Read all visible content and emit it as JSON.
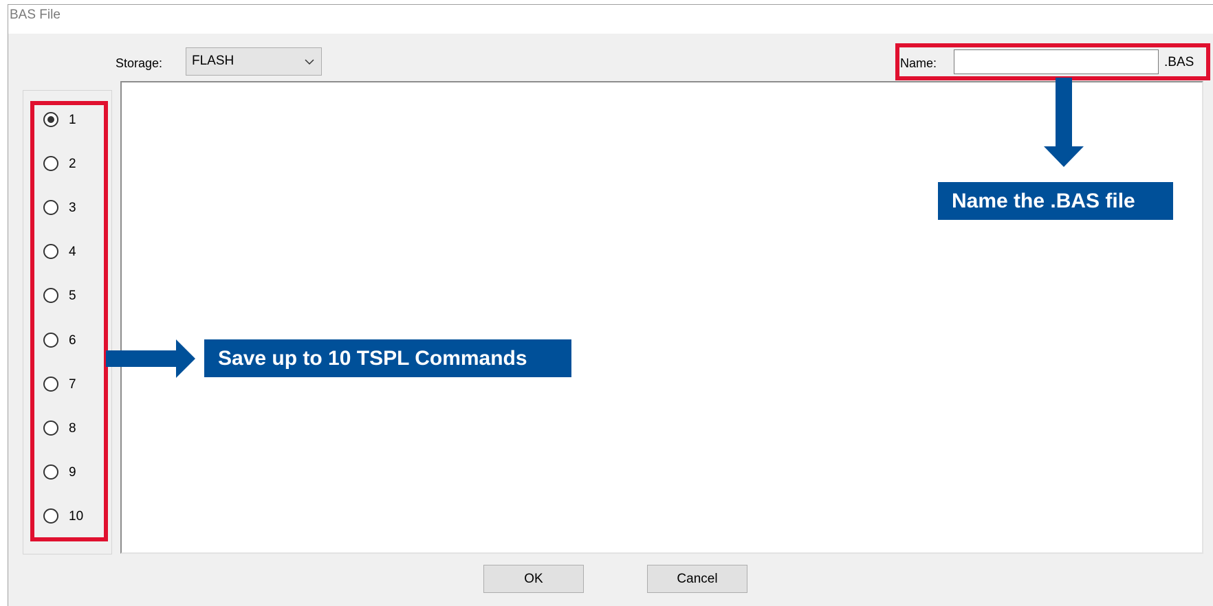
{
  "window": {
    "title": "BAS File"
  },
  "storage": {
    "label": "Storage:",
    "value": "FLASH"
  },
  "name_field": {
    "label": "Name:",
    "value": "",
    "suffix": ".BAS"
  },
  "radios": {
    "items": [
      {
        "label": "1",
        "checked": true
      },
      {
        "label": "2",
        "checked": false
      },
      {
        "label": "3",
        "checked": false
      },
      {
        "label": "4",
        "checked": false
      },
      {
        "label": "5",
        "checked": false
      },
      {
        "label": "6",
        "checked": false
      },
      {
        "label": "7",
        "checked": false
      },
      {
        "label": "8",
        "checked": false
      },
      {
        "label": "9",
        "checked": false
      },
      {
        "label": "10",
        "checked": false
      }
    ]
  },
  "buttons": {
    "ok": "OK",
    "cancel": "Cancel"
  },
  "annotations": {
    "name_callout": "Name the .BAS file",
    "commands_callout": "Save up to 10 TSPL Commands",
    "highlight_color": "#e0102f",
    "callout_color": "#005099"
  }
}
